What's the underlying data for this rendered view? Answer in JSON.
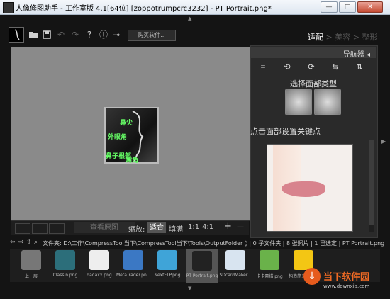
{
  "window": {
    "title": "人像修图助手 - 工作室版 4.1[64位] [zoppotrumpcrc3232] - PT Portrait.png*",
    "buttons": [
      "—",
      "□",
      "✕"
    ]
  },
  "toolbar": {
    "buy_label": "购买软件...",
    "icons": [
      "logo-icon",
      "open-folder-icon",
      "save-icon",
      "undo-icon",
      "redo-icon",
      "help-icon",
      "info-icon",
      "plug-icon"
    ]
  },
  "steps": {
    "active": "适配",
    "sep1": " > ",
    "second": "美容",
    "sep2": " > ",
    "third": "整形"
  },
  "canvas": {
    "face_points": [
      "鼻尖",
      "外眼角",
      "鼻子根部",
      "嘴角"
    ]
  },
  "navigator": {
    "title": "导航器 ◂",
    "icons": [
      "crop-icon",
      "rotate-left-icon",
      "rotate-right-icon",
      "flip-h-icon",
      "flip-v-icon"
    ],
    "face_type_title": "选择面部类型",
    "keypoint_title": "点击面部设置关键点"
  },
  "zoom": {
    "view_original": "查看原图",
    "label": "缩放:",
    "fit": "适合",
    "fill": "填满",
    "one_to_one": "1:1",
    "four_to_one": "4:1",
    "plus": "+",
    "minus": "—"
  },
  "path": {
    "text": "文件夹: D:\\工作\\CompressTool当下\\CompressTool当下\\Tools\\OutputFolder ◊ | 0 子文件夹 | 8 张照片 | 1 已选定 | PT Portrait.png"
  },
  "filmstrip": [
    {
      "label": "上一层",
      "color": "#777",
      "selected": false
    },
    {
      "label": "ClassIn.png",
      "color": "#2c6e7a",
      "selected": false
    },
    {
      "label": "dadaxx.png",
      "color": "#eeeeee",
      "selected": false
    },
    {
      "label": "MetaTrader.pn...",
      "color": "#3b78c4",
      "selected": false
    },
    {
      "label": "NextFTP.png",
      "color": "#3fa4d8",
      "selected": false
    },
    {
      "label": "PT Portrait.png",
      "color": "#222222",
      "selected": true
    },
    {
      "label": "SDcardMaker...",
      "color": "#d8e4f0",
      "selected": false
    },
    {
      "label": "卡卡素描.png",
      "color": "#6ab24a",
      "selected": false
    },
    {
      "label": "构造简习软件...",
      "color": "#f3c614",
      "selected": false
    }
  ],
  "watermark": {
    "name": "当下软件园",
    "url": "www.downxia.com"
  }
}
